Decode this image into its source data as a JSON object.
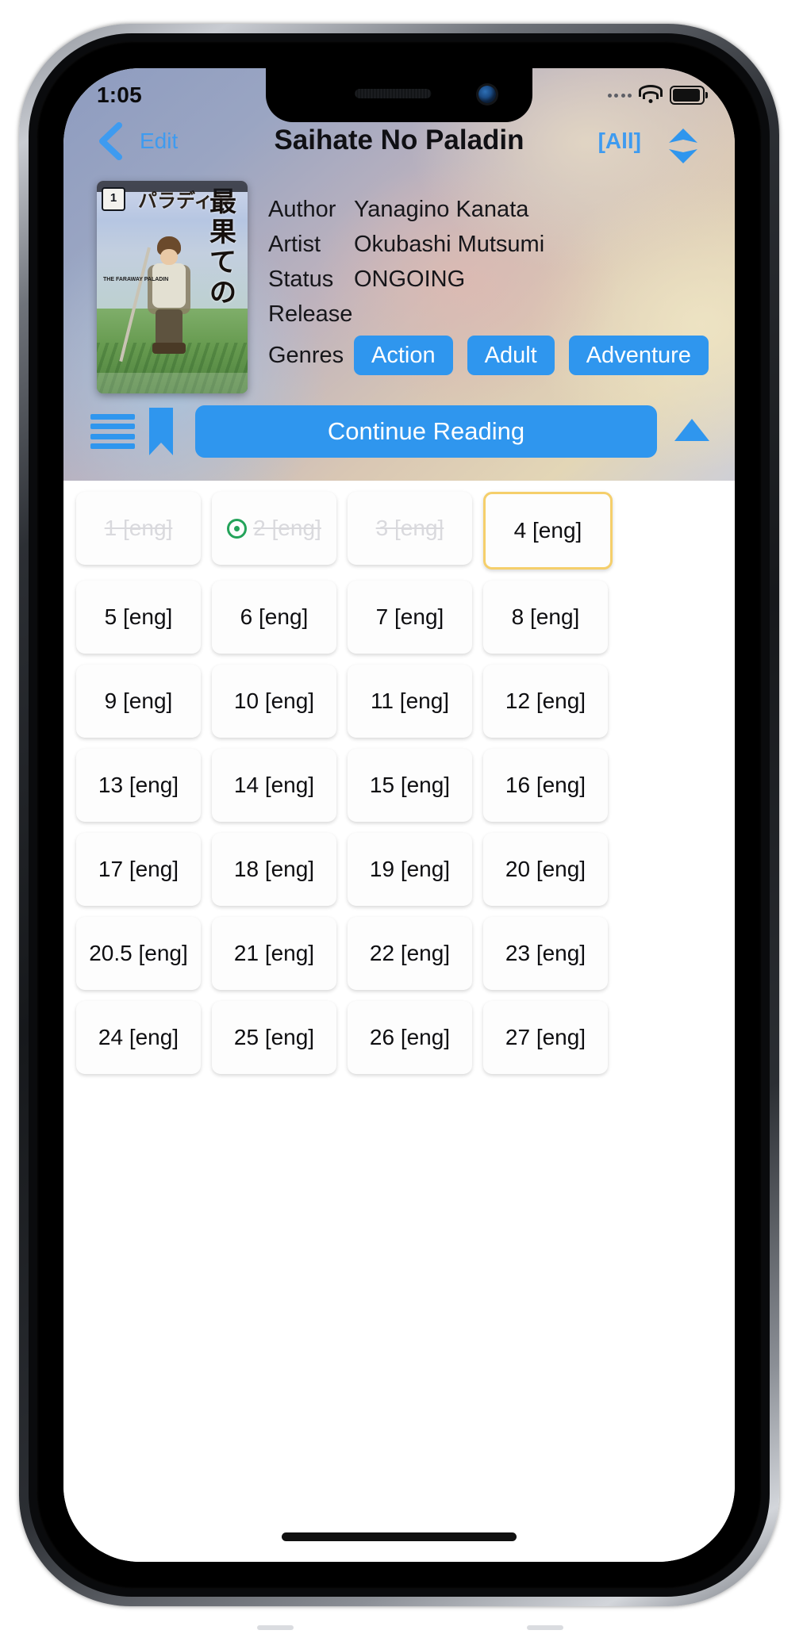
{
  "status_bar": {
    "time": "1:05",
    "cellular_icon": "signal-dots-icon",
    "wifi_icon": "wifi-icon",
    "battery_icon": "battery-icon"
  },
  "nav": {
    "back_icon": "chevron-left-icon",
    "edit_label": "Edit",
    "title": "Saihate No Paladin",
    "filter_label": "[All]",
    "sort_icon": "sort-updown-icon"
  },
  "cover": {
    "volume_badge": "1",
    "jp_title": "最果ての",
    "katakana": "パラディン",
    "small_text": "THE FARAWAY PALADIN"
  },
  "info": {
    "rows": [
      {
        "key": "Author",
        "value": "Yanagino Kanata"
      },
      {
        "key": "Artist",
        "value": "Okubashi Mutsumi"
      },
      {
        "key": "Status",
        "value": "ONGOING"
      },
      {
        "key": "Release",
        "value": ""
      }
    ],
    "genres_label": "Genres",
    "genres": [
      "Action",
      "Adult",
      "Adventure"
    ]
  },
  "action_bar": {
    "list_icon": "list-lines-icon",
    "bookmark_icon": "bookmark-icon",
    "continue_label": "Continue Reading",
    "scroll_top_icon": "triangle-up-icon"
  },
  "colors": {
    "accent_blue": "#2f96ee",
    "link_blue": "#3e9bf0",
    "current_border": "#f5cf6b",
    "downloaded_green": "#24a35a",
    "read_text": "#d9d9dd"
  },
  "chapters": [
    {
      "label": "1 [eng]",
      "read": true,
      "downloaded": false,
      "current": false
    },
    {
      "label": "2 [eng]",
      "read": true,
      "downloaded": true,
      "current": false
    },
    {
      "label": "3 [eng]",
      "read": true,
      "downloaded": false,
      "current": false
    },
    {
      "label": "4 [eng]",
      "read": false,
      "downloaded": false,
      "current": true
    },
    {
      "label": "5 [eng]",
      "read": false,
      "downloaded": false,
      "current": false
    },
    {
      "label": "6 [eng]",
      "read": false,
      "downloaded": false,
      "current": false
    },
    {
      "label": "7 [eng]",
      "read": false,
      "downloaded": false,
      "current": false
    },
    {
      "label": "8 [eng]",
      "read": false,
      "downloaded": false,
      "current": false
    },
    {
      "label": "9 [eng]",
      "read": false,
      "downloaded": false,
      "current": false
    },
    {
      "label": "10 [eng]",
      "read": false,
      "downloaded": false,
      "current": false
    },
    {
      "label": "11 [eng]",
      "read": false,
      "downloaded": false,
      "current": false
    },
    {
      "label": "12 [eng]",
      "read": false,
      "downloaded": false,
      "current": false
    },
    {
      "label": "13 [eng]",
      "read": false,
      "downloaded": false,
      "current": false
    },
    {
      "label": "14 [eng]",
      "read": false,
      "downloaded": false,
      "current": false
    },
    {
      "label": "15 [eng]",
      "read": false,
      "downloaded": false,
      "current": false
    },
    {
      "label": "16 [eng]",
      "read": false,
      "downloaded": false,
      "current": false
    },
    {
      "label": "17 [eng]",
      "read": false,
      "downloaded": false,
      "current": false
    },
    {
      "label": "18 [eng]",
      "read": false,
      "downloaded": false,
      "current": false
    },
    {
      "label": "19 [eng]",
      "read": false,
      "downloaded": false,
      "current": false
    },
    {
      "label": "20 [eng]",
      "read": false,
      "downloaded": false,
      "current": false
    },
    {
      "label": "20.5 [eng]",
      "read": false,
      "downloaded": false,
      "current": false
    },
    {
      "label": "21 [eng]",
      "read": false,
      "downloaded": false,
      "current": false
    },
    {
      "label": "22 [eng]",
      "read": false,
      "downloaded": false,
      "current": false
    },
    {
      "label": "23 [eng]",
      "read": false,
      "downloaded": false,
      "current": false
    },
    {
      "label": "24 [eng]",
      "read": false,
      "downloaded": false,
      "current": false
    },
    {
      "label": "25 [eng]",
      "read": false,
      "downloaded": false,
      "current": false
    },
    {
      "label": "26 [eng]",
      "read": false,
      "downloaded": false,
      "current": false
    },
    {
      "label": "27 [eng]",
      "read": false,
      "downloaded": false,
      "current": false
    }
  ]
}
